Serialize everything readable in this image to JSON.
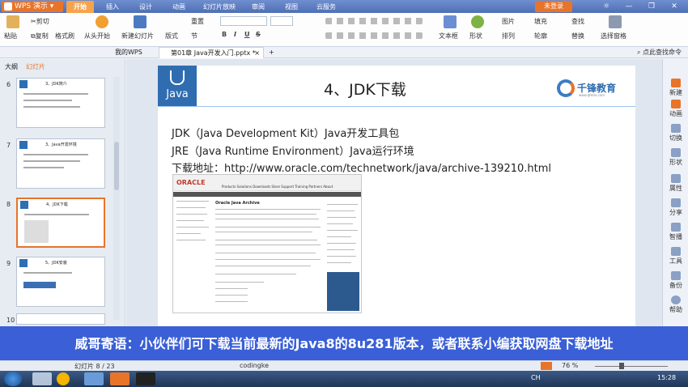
{
  "titlebar": {
    "app_name": "WPS 演示",
    "tabs": [
      "开始",
      "插入",
      "设计",
      "动画",
      "幻灯片放映",
      "审阅",
      "视图",
      "云服务"
    ],
    "active_tab": "开始",
    "login": "未登录",
    "minimize": "—",
    "restore": "❐",
    "close": "✕"
  },
  "ribbon": {
    "paste": "粘贴",
    "cut": "剪切",
    "copy": "复制",
    "format_painter": "格式刷",
    "from_start": "从头开始",
    "new_slide": "新建幻灯片",
    "layout": "版式",
    "section": "节",
    "reset": "重置",
    "bold": "B",
    "italic": "I",
    "underline": "U",
    "strike": "S",
    "text_box": "文本框",
    "shape": "形状",
    "arrange": "排列",
    "picture": "图片",
    "fill": "填充",
    "outline": "轮廓",
    "find": "查找",
    "replace": "替换",
    "select_pane": "选择窗格"
  },
  "tabbar": {
    "my_wps": "我的WPS",
    "doc_name": "第01章 Java开发入门.pptx *",
    "close_tab": "×",
    "add_tab": "+",
    "search_hint": "点此查找命令"
  },
  "leftpanel": {
    "outline_tab": "大纲",
    "slides_tab": "幻灯片",
    "thumbnails": [
      {
        "num": "6",
        "title": "3、JDK简介"
      },
      {
        "num": "7",
        "title": "3、Java开发环境"
      },
      {
        "num": "8",
        "title": "4、JDK下载"
      },
      {
        "num": "9",
        "title": "5、JDK安装"
      },
      {
        "num": "10",
        "title": ""
      }
    ]
  },
  "slide": {
    "logo_text": "Java",
    "title": "4、JDK下载",
    "brand": "千锋教育",
    "brand_sub": "www.qfedu.com",
    "lines": [
      "JDK（Java Development Kit）Java开发工具包",
      "JRE（Java Runtime Environment）Java运行环境",
      "下载地址：http://www.oracle.com/technetwork/java/archive-139210.html"
    ],
    "oracle": {
      "brand": "ORACLE",
      "nav": "Products  Solutions  Downloads  Store  Support  Training  Partners  About",
      "heading": "Oracle Java Archive"
    }
  },
  "caption": "威哥寄语：小伙伴们可下载当前最新的Java8的8u281版本，或者联系小编获取网盘下载地址",
  "rightpanel": [
    "新建",
    "动画",
    "切换",
    "形状",
    "属性",
    "分享",
    "智播",
    "工具",
    "备份",
    "帮助"
  ],
  "statusbar": {
    "slide_info": "幻灯片 8 / 23",
    "theme": "codingke",
    "zoom": "76 %"
  },
  "taskbar": {
    "lang": "CH",
    "time": "15:28"
  },
  "colors": {
    "accent_orange": "#e8742a",
    "caption_blue": "#3a5fd6",
    "java_blue": "#2f6db0"
  }
}
